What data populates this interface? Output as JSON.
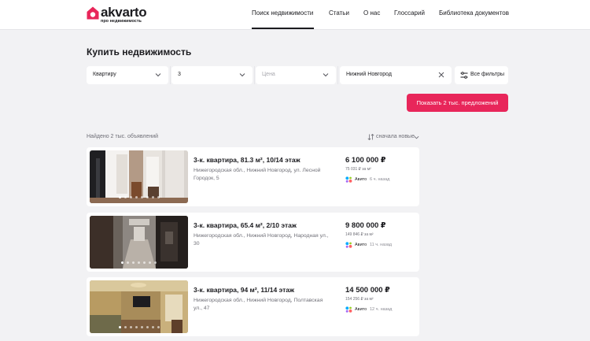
{
  "header": {
    "logo_text": "akvarto",
    "logo_subtitle": "про недвижимость",
    "nav": [
      {
        "label": "Поиск недвижимости",
        "active": true
      },
      {
        "label": "Статьи",
        "active": false
      },
      {
        "label": "О нас",
        "active": false
      },
      {
        "label": "Глоссарий",
        "active": false
      },
      {
        "label": "Библиотека документов",
        "active": false
      }
    ]
  },
  "page_title": "Купить недвижимость",
  "filters": {
    "type": "Квартиру",
    "rooms": "3",
    "price_placeholder": "Цена",
    "city": "Нижний Новгород",
    "all_filters_label": "Все фильтры"
  },
  "show_button": "Показать 2 тыс. предложений",
  "found_text": "Найдено 2 тыс. объявлений",
  "sort_label": "сначала новые",
  "listings": [
    {
      "title": "3-к. квартира, 81.3 м², 10/14 этаж",
      "address": "Нижегородская обл., Нижний Новгород, ул. Лесной Городок, 5",
      "price": "6 100 000 ₽",
      "price_per_m2": "75 031 ₽ за м²",
      "source": "Авито",
      "time_ago": "6 ч. назад",
      "active_dot": 0,
      "dots_count": 8
    },
    {
      "title": "3-к. квартира, 65.4 м², 2/10 этаж",
      "address": "Нижегородская обл., Нижний Новгород, Народная ул., 30",
      "price": "9 800 000 ₽",
      "price_per_m2": "149 846 ₽ за м²",
      "source": "Авито",
      "time_ago": "11 ч. назад",
      "active_dot": 0,
      "dots_count": 7
    },
    {
      "title": "3-к. квартира, 94 м², 11/14 этаж",
      "address": "Нижегородская обл., Нижний Новгород, Полтавская ул., 47",
      "price": "14 500 000 ₽",
      "price_per_m2": "154 256 ₽ за м²",
      "source": "Авито",
      "time_ago": "12 ч. назад",
      "active_dot": 0,
      "dots_count": 8
    }
  ],
  "colors": {
    "accent": "#e8265a",
    "background": "#f2f2f4",
    "card": "#ffffff",
    "text": "#1b1b1f",
    "muted": "#707078"
  },
  "icons": {
    "logo": "house-logo-icon",
    "chevron": "chevron-down-icon",
    "clear": "close-icon",
    "filters": "sliders-icon",
    "sort": "sort-icon",
    "source": "avito-icon"
  }
}
